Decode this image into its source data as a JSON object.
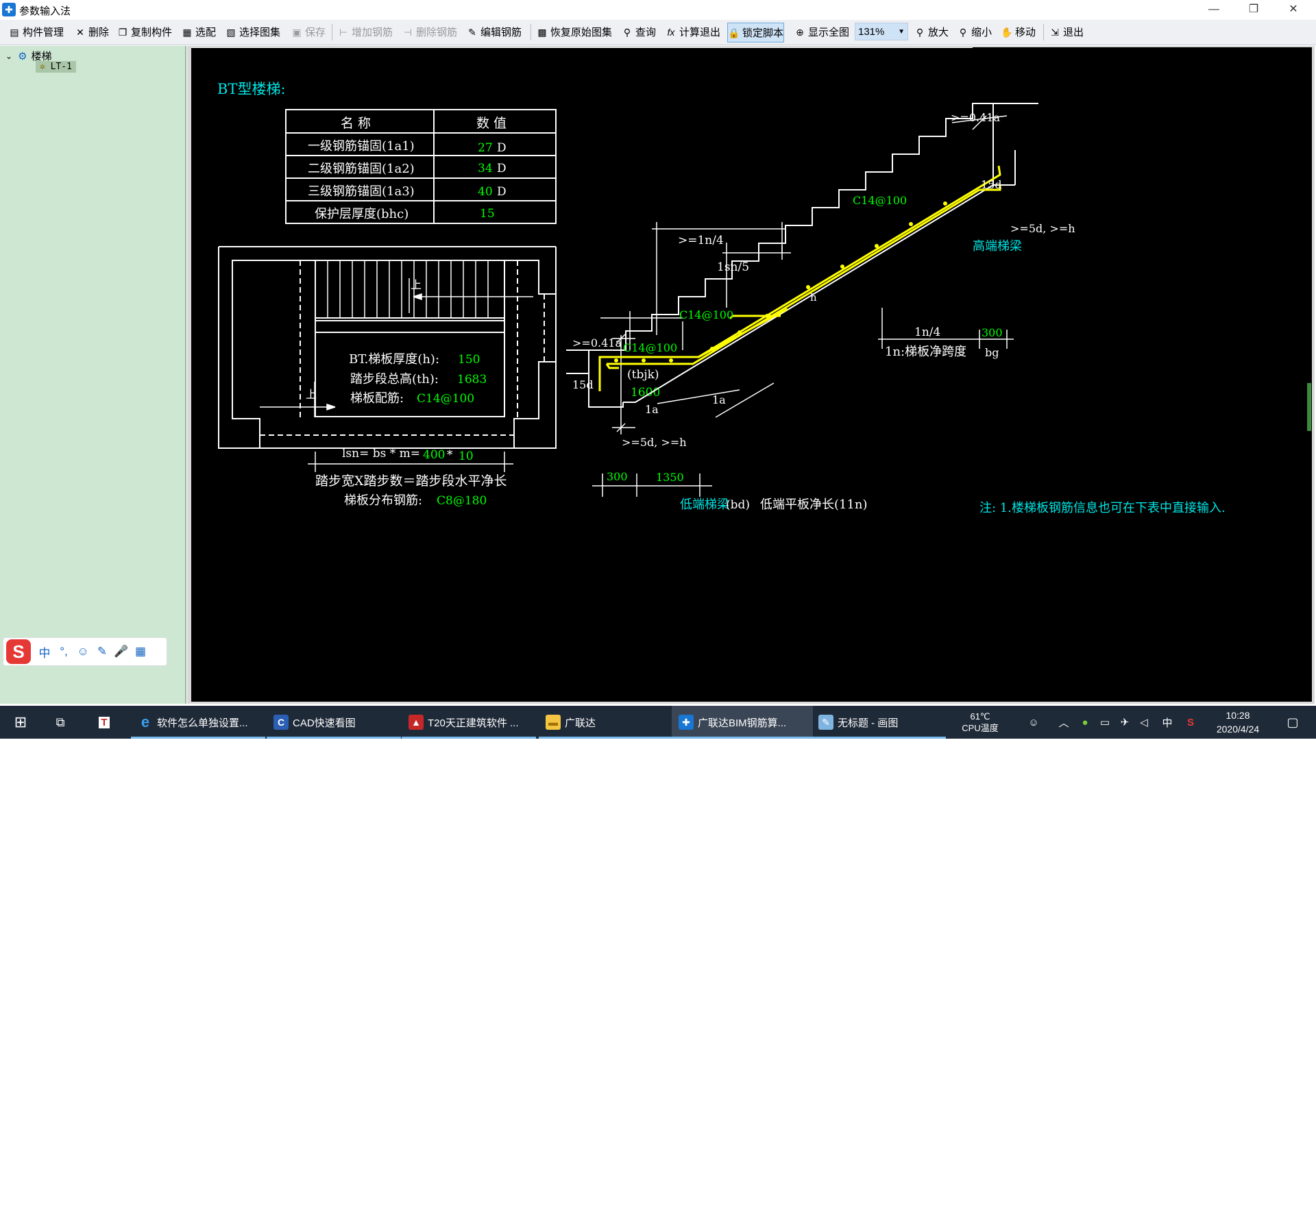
{
  "window": {
    "title": "参数输入法",
    "icon": "glodon-app-icon",
    "min": "—",
    "restore": "❐",
    "close": "✕"
  },
  "toolbar": {
    "items": [
      {
        "id": "component-manage",
        "label": "构件管理",
        "icon": "component-icon"
      },
      {
        "id": "delete",
        "label": "删除",
        "icon": "delete-icon"
      },
      {
        "id": "copy-component",
        "label": "复制构件",
        "icon": "copy-icon"
      },
      {
        "id": "select",
        "label": "选配",
        "icon": "select-icon"
      },
      {
        "id": "select-atlas",
        "label": "选择图集",
        "icon": "atlas-icon"
      },
      {
        "id": "save",
        "label": "保存",
        "icon": "save-icon",
        "disabled": true
      },
      {
        "id": "add-rebar",
        "label": "增加钢筋",
        "icon": "add-rebar-icon",
        "disabled": true
      },
      {
        "id": "delete-rebar",
        "label": "删除钢筋",
        "icon": "delete-rebar-icon",
        "disabled": true
      },
      {
        "id": "edit-rebar",
        "label": "编辑钢筋",
        "icon": "edit-rebar-icon"
      },
      {
        "id": "restore-atlas",
        "label": "恢复原始图集",
        "icon": "restore-icon"
      },
      {
        "id": "query",
        "label": "查询",
        "icon": "binoculars-icon"
      },
      {
        "id": "calc-exit",
        "label": "计算退出",
        "icon": "fx-icon"
      },
      {
        "id": "lock-script",
        "label": "锁定脚本",
        "icon": "lock-icon",
        "active": true
      },
      {
        "id": "show-all",
        "label": "显示全图",
        "icon": "zoom-fit-icon"
      },
      {
        "id": "zoom-in",
        "label": "放大",
        "icon": "zoom-in-icon"
      },
      {
        "id": "zoom-out",
        "label": "缩小",
        "icon": "zoom-out-icon"
      },
      {
        "id": "move",
        "label": "移动",
        "icon": "hand-icon"
      },
      {
        "id": "exit",
        "label": "退出",
        "icon": "exit-icon"
      }
    ],
    "zoom_value": "131%"
  },
  "tree": {
    "root_label": "楼梯",
    "child_label": "LT-1"
  },
  "ime": {
    "logo": "S",
    "items": [
      "中",
      "°,",
      "☺",
      "✎",
      "🎤",
      "▦"
    ]
  },
  "drawing": {
    "title": "BT型楼梯:",
    "table": {
      "headers": [
        "名  称",
        "数  值"
      ],
      "rows": [
        {
          "name": "一级钢筋锚固(1a1)",
          "value": "27",
          "unit": "D"
        },
        {
          "name": "二级钢筋锚固(1a2)",
          "value": "34",
          "unit": "D"
        },
        {
          "name": "三级钢筋锚固(1a3)",
          "value": "40",
          "unit": "D"
        },
        {
          "name": "保护层厚度(bhc)",
          "value": "15",
          "unit": ""
        }
      ]
    },
    "plan": {
      "up1": "上",
      "up2": "上",
      "thickness_label": "BT.梯板厚度(h):",
      "thickness_value": "150",
      "height_label": "踏步段总高(th):",
      "height_value": "1683",
      "rebar_label": "梯板配筋:",
      "rebar_value": "C14@100",
      "tbjk_label": "(tbjk)",
      "tbjk_value": "1600",
      "lsn_label": "lsn= bs * m=",
      "bs_value": "400",
      "star": "*",
      "m_value": "10",
      "formula": "踏步宽X踏步数＝踏步段水平净长",
      "dist_label": "梯板分布钢筋:",
      "dist_value": "C8@180"
    },
    "section": {
      "top_04la": ">=0.41a",
      "top_15d": "15d",
      "top_5d": ">=5d, >=h",
      "high_beam": "高端梯梁",
      "rebar_top": "C14@100",
      "rebar_mid": "C14@100",
      "rebar_low": "C14@100",
      "ln4_top": ">=1n/4",
      "lsn5": "1sn/5",
      "h": "h",
      "left_04la": ">=0.41a",
      "left_15d": "15d",
      "la1": "1a",
      "la2": "1a",
      "bot_5d": ">=5d, >=h",
      "ln4_right": "1n/4",
      "ln_desc": "1n:梯板净跨度",
      "bg_value": "300",
      "bg": "bg",
      "low_300": "300",
      "low_1350": "1350",
      "low_beam": "低端梯梁",
      "low_bd": "(bd)",
      "low_plat": "低端平板净长(11n)",
      "note": "注: 1.楼梯板钢筋信息也可在下表中直接输入."
    }
  },
  "taskbar": {
    "apps": [
      {
        "label": "软件怎么单独设置...",
        "icon": "edge-icon"
      },
      {
        "label": "CAD快速看图",
        "icon": "cad-viewer-icon"
      },
      {
        "label": "T20天正建筑软件 ...",
        "icon": "t20-icon"
      },
      {
        "label": "广联达",
        "icon": "folder-icon"
      },
      {
        "label": "广联达BIM钢筋算...",
        "icon": "glodon-icon",
        "active": true
      },
      {
        "label": "无标题 - 画图",
        "icon": "paint-icon"
      }
    ],
    "temp": "61℃",
    "temp_label": "CPU温度",
    "ime_lang": "中",
    "time": "10:28",
    "date": "2020/4/24"
  },
  "colors": {
    "cad_white": "#ffffff",
    "cad_green": "#00ff00",
    "cad_cyan": "#00e5e5",
    "cad_yellow": "#ffff00"
  }
}
